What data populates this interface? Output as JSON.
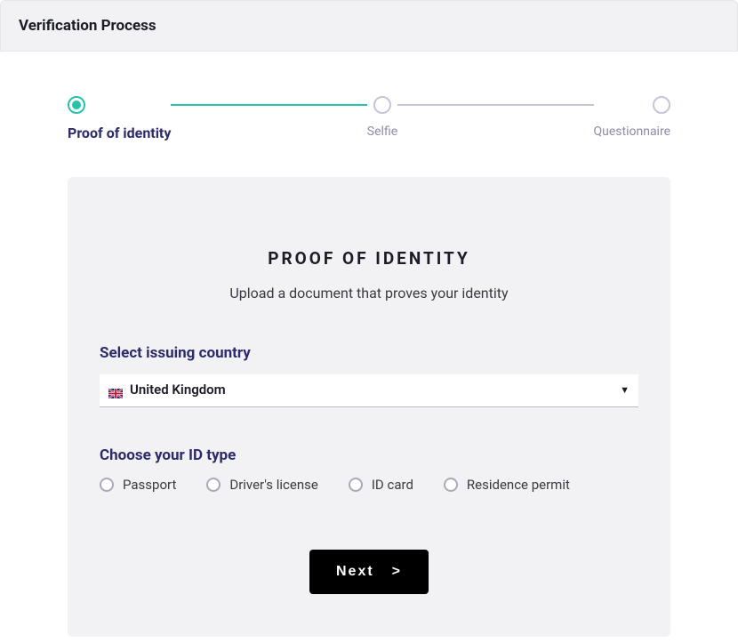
{
  "header": {
    "title": "Verification Process"
  },
  "stepper": {
    "steps": [
      {
        "label": "Proof of identity",
        "active": true
      },
      {
        "label": "Selfie",
        "active": false
      },
      {
        "label": "Questionnaire",
        "active": false
      }
    ]
  },
  "card": {
    "title": "PROOF OF IDENTITY",
    "subtitle": "Upload a document that proves your identity",
    "country_label": "Select issuing country",
    "country_value": "United Kingdom",
    "id_type_label": "Choose your ID type",
    "id_types": [
      "Passport",
      "Driver's license",
      "ID card",
      "Residence permit"
    ],
    "next_button": "Next"
  }
}
